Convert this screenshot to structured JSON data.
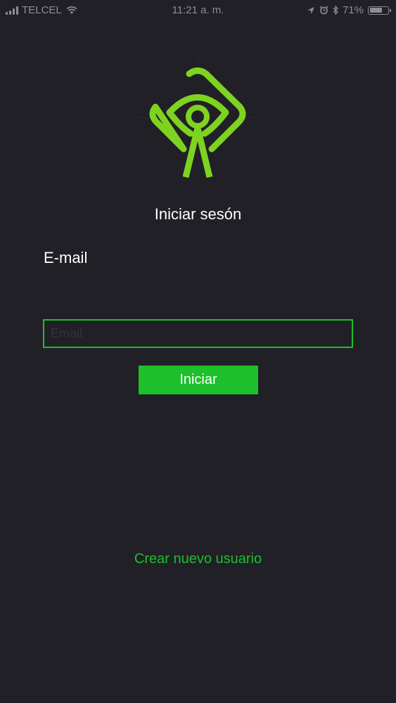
{
  "status_bar": {
    "carrier": "TELCEL",
    "time": "11:21 a. m.",
    "battery_percent": "71%",
    "battery_level": 0.71,
    "icons": [
      "signal-icon",
      "wifi-icon",
      "location-icon",
      "alarm-icon",
      "bluetooth-icon",
      "battery-icon"
    ]
  },
  "logo": {
    "icon": "eye-person-logo",
    "color": "#7ed321"
  },
  "login": {
    "title": "Iniciar sesón",
    "email_label": "E-mail",
    "email_placeholder": "Email",
    "email_value": "",
    "submit_label": "Iniciar",
    "create_user_label": "Crear nuevo usuario"
  },
  "colors": {
    "background": "#212027",
    "accent": "#1dbf2a",
    "logo_green": "#7ed321",
    "text": "#ffffff"
  }
}
